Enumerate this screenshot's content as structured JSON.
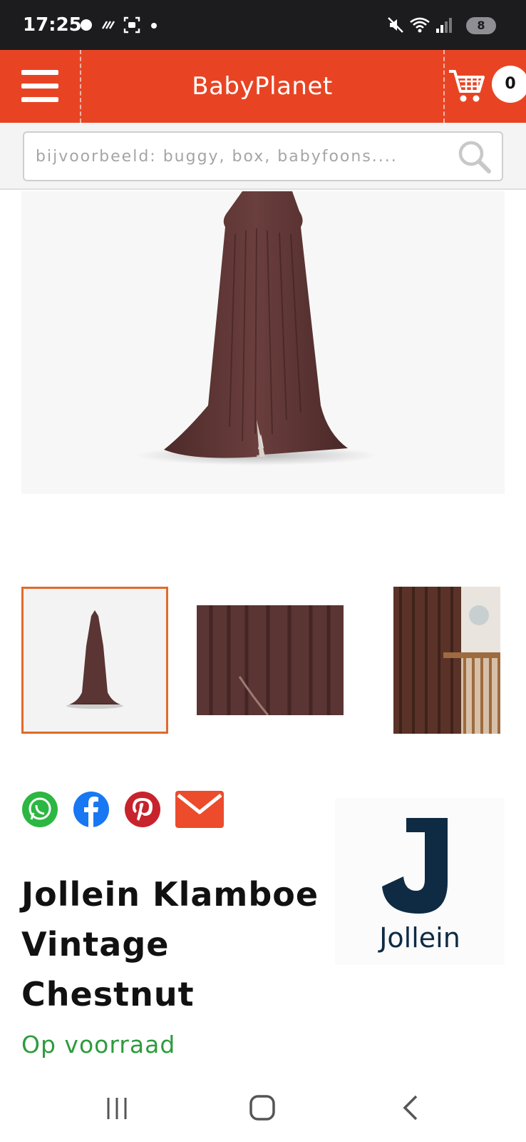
{
  "status_bar": {
    "time": "17:25",
    "battery": "8"
  },
  "header": {
    "brand": "BabyPlanet",
    "cart_count": "0",
    "background": "#e84424"
  },
  "search": {
    "placeholder": "bijvoorbeeld: buggy, box, babyfoons...."
  },
  "product": {
    "title_lines": [
      "Jollein Klamboe",
      "Vintage",
      "Chestnut"
    ],
    "stock_status": "Op voorraad",
    "brand_logo_text": "Jollein",
    "thumbnails": [
      "canopy-full",
      "fabric-closeup",
      "nursery-scene"
    ]
  },
  "share": {
    "icons": [
      "whatsapp-icon",
      "facebook-icon",
      "pinterest-icon",
      "email-icon"
    ]
  },
  "colors": {
    "accent": "#e84424",
    "stock_green": "#2e9b3e",
    "chestnut": "#5a3534",
    "thumb_border": "#e06a2b",
    "brand_navy": "#0f2b44"
  }
}
